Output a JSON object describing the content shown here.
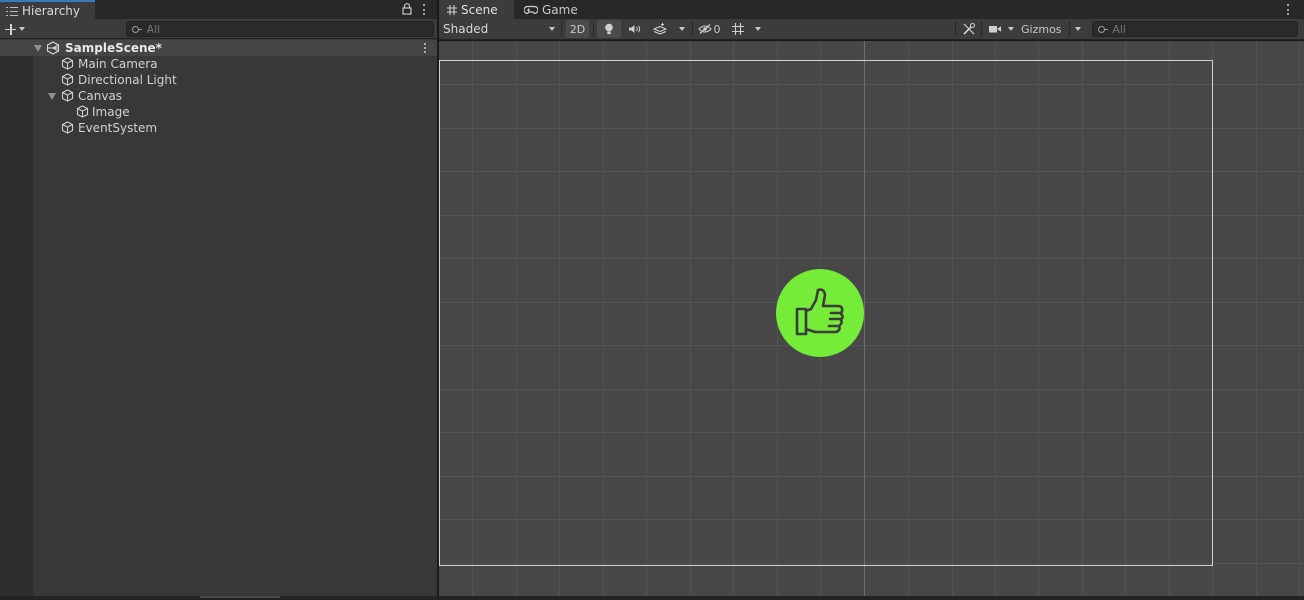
{
  "hierarchy": {
    "tab_label": "Hierarchy",
    "search_placeholder": "All",
    "scene": {
      "name": "SampleScene*",
      "expanded": true
    },
    "items": [
      {
        "label": "Main Camera",
        "depth": 1,
        "has_children": false
      },
      {
        "label": "Directional Light",
        "depth": 1,
        "has_children": false
      },
      {
        "label": "Canvas",
        "depth": 1,
        "has_children": true,
        "expanded": true
      },
      {
        "label": "Image",
        "depth": 2,
        "has_children": false
      },
      {
        "label": "EventSystem",
        "depth": 1,
        "has_children": false
      }
    ]
  },
  "scene_view": {
    "tabs": [
      {
        "label": "Scene",
        "icon": "grid-icon",
        "active": true
      },
      {
        "label": "Game",
        "icon": "gamepad-icon",
        "active": false
      }
    ],
    "draw_mode": "Shaded",
    "toggle_2d_label": "2D",
    "toggle_2d_active": true,
    "hidden_count": "0",
    "gizmos_label": "Gizmos",
    "search_placeholder": "All",
    "image_sprite": {
      "icon": "thumbs-up-icon",
      "color": "#74ec38"
    }
  },
  "colors": {
    "tab_accent": "#3a79bb",
    "panel_bg": "#383838",
    "viewport_bg": "#474747",
    "sprite_fill": "#74ec38"
  }
}
